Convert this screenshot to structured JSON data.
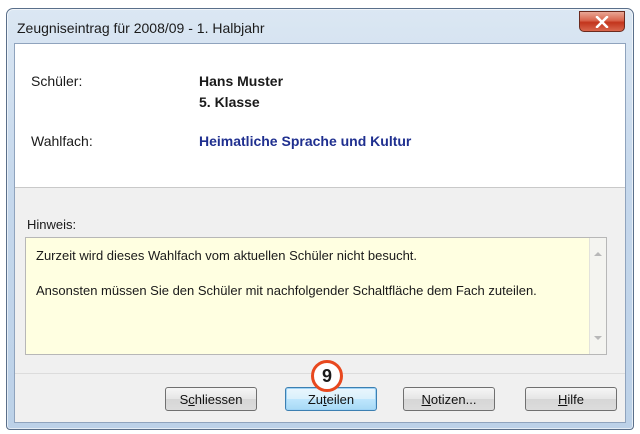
{
  "window": {
    "title": "Zeugniseintrag für 2008/09 - 1. Halbjahr"
  },
  "student": {
    "label": "Schüler:",
    "name": "Hans Muster",
    "class": "5. Klasse"
  },
  "elective": {
    "label": "Wahlfach:",
    "value": "Heimatliche Sprache und Kultur"
  },
  "hint": {
    "label": "Hinweis:",
    "line1": "Zurzeit wird dieses Wahlfach vom aktuellen Schüler nicht besucht.",
    "line2": "Ansonsten müssen Sie den Schüler mit nachfolgender Schaltfläche dem Fach zuteilen."
  },
  "buttons": {
    "close": {
      "pre": "S",
      "accel": "c",
      "post": "hliessen"
    },
    "assign": {
      "pre": "Zu",
      "accel": "t",
      "post": "eilen"
    },
    "notes": {
      "pre": "",
      "accel": "N",
      "post": "otizen..."
    },
    "help": {
      "pre": "",
      "accel": "H",
      "post": "ilfe"
    }
  },
  "callout": {
    "number": "9"
  },
  "colors": {
    "link": "#1f2f8f",
    "hint_bg": "#ffffe1",
    "callout_ring": "#e8481e",
    "close_button": "#c2351c"
  },
  "icons": {
    "close": "close-icon",
    "scroll_up": "arrow-up-icon",
    "scroll_down": "arrow-down-icon"
  }
}
